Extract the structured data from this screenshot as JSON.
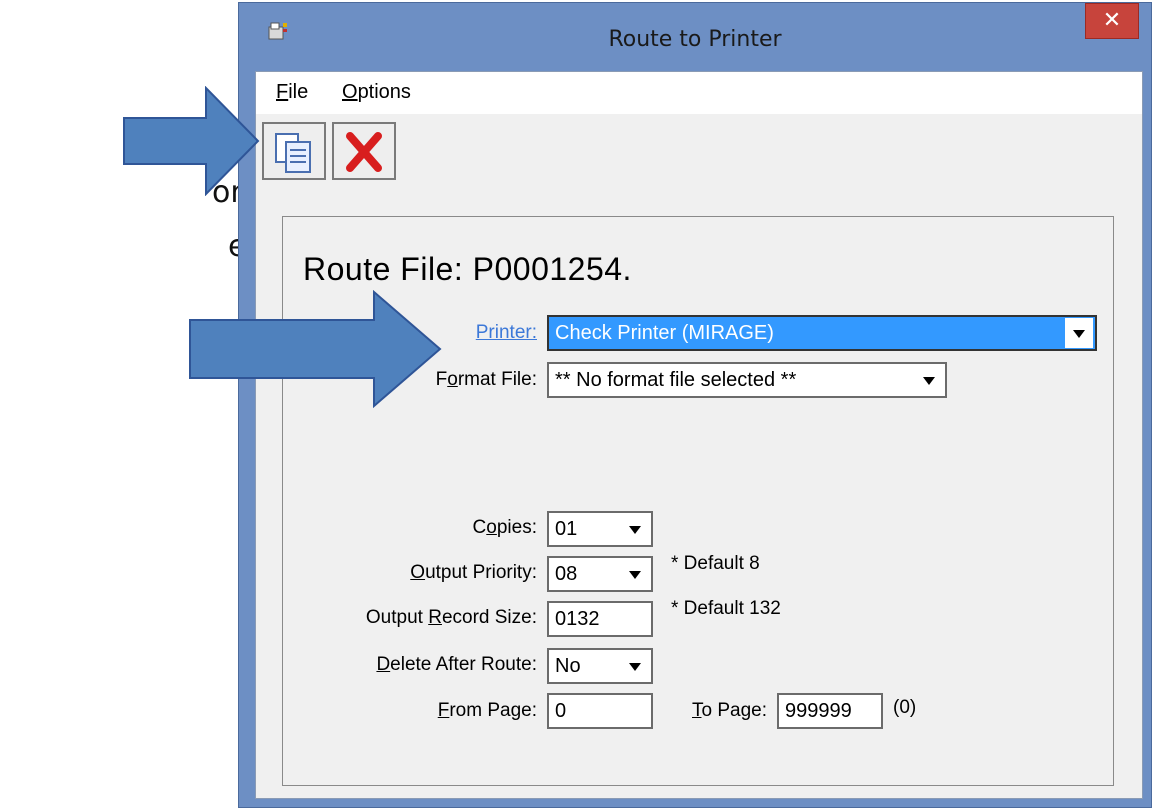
{
  "slide_fragments": [
    "on",
    "e"
  ],
  "window": {
    "title": "Route to Printer",
    "close_glyph": "✕"
  },
  "menu": {
    "file": {
      "accel": "F",
      "rest": "ile"
    },
    "options": {
      "accel": "O",
      "rest": "ptions"
    }
  },
  "toolbar": {
    "copy_icon": "copy-pages-icon",
    "delete_icon": "red-x-icon"
  },
  "form": {
    "route_file": "Route File: P0001254.",
    "printer_label": "Printer:",
    "printer_value": "Check Printer (MIRAGE)",
    "format_label": {
      "a": "F",
      "accel": "o",
      "b": "rmat File:"
    },
    "format_value": "** No format file selected **",
    "copies_label": {
      "a": "C",
      "accel": "o",
      "b": "pies:"
    },
    "copies_value": "01",
    "priority_label": {
      "accel": "O",
      "b": "utput Priority:"
    },
    "priority_value": "08",
    "priority_note": "* Default 8",
    "record_label": {
      "a": "Output ",
      "accel": "R",
      "b": "ecord Size:"
    },
    "record_value": "0132",
    "record_note": "* Default 132",
    "delete_label": {
      "accel": "D",
      "b": "elete After Route:"
    },
    "delete_value": "No",
    "from_label": {
      "accel": "F",
      "b": "rom Page:"
    },
    "from_value": "0",
    "to_label": {
      "accel": "T",
      "b": "o Page:"
    },
    "to_value": "999999",
    "to_note": "(0)"
  },
  "colors": {
    "arrow": "#4f81bd",
    "window_frame": "#6d8fc4",
    "selection": "#3399ff",
    "close": "#c7443c"
  }
}
